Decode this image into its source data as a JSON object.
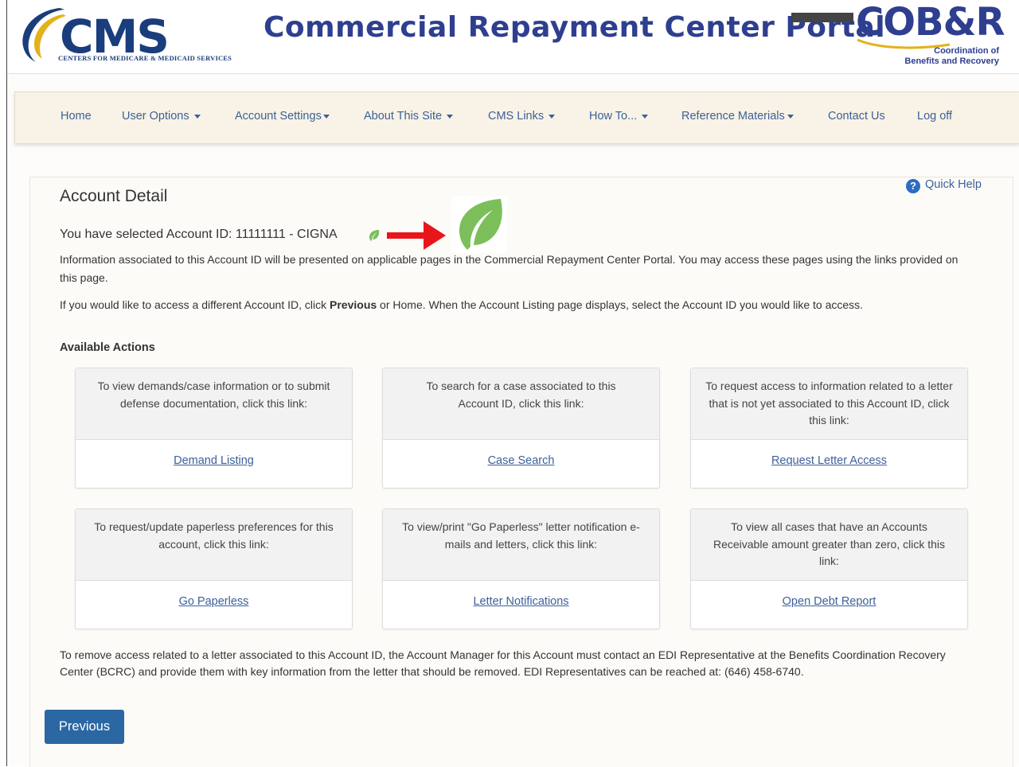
{
  "header": {
    "cms_logo_text": "CMS",
    "cms_logo_subtitle": "CENTERS FOR MEDICARE & MEDICAID SERVICES",
    "portal_title": "Commercial Repayment Center Portal",
    "cobr_logo_text": "COB&R",
    "cobr_logo_line1": "Coordination of",
    "cobr_logo_line2": "Benefits and Recovery"
  },
  "nav": {
    "items": [
      {
        "label": "Home",
        "dropdown": false
      },
      {
        "label": "User Options",
        "dropdown": true
      },
      {
        "label": "Account Settings",
        "dropdown": true
      },
      {
        "label": "About This Site",
        "dropdown": true
      },
      {
        "label": "CMS Links",
        "dropdown": true
      },
      {
        "label": "How To...",
        "dropdown": true
      },
      {
        "label": "Reference Materials",
        "dropdown": true
      },
      {
        "label": "Contact Us",
        "dropdown": false
      },
      {
        "label": "Log off",
        "dropdown": false
      }
    ]
  },
  "main": {
    "title": "Account Detail",
    "quick_help": "Quick Help",
    "selected_account": "You have selected Account ID: 11111111 - CIGNA",
    "info_para": "Information associated to this Account ID will be presented on applicable pages in the Commercial Repayment Center Portal. You may access these pages using the links provided on this page.",
    "access_para_before": "If you would like to access a different Account ID, click ",
    "access_para_bold": "Previous",
    "access_para_after": " or Home. When the Account Listing page displays, select the Account ID you would like to access.",
    "available_actions": "Available Actions",
    "cards": [
      {
        "text": "To view demands/case information or to submit defense documentation, click this link:",
        "link": "Demand Listing"
      },
      {
        "text": "To search for a case associated to this Account ID, click this link:",
        "link": "Case Search"
      },
      {
        "text": "To request access to information related to a letter that is not yet associated to this Account ID, click this link:",
        "link": "Request Letter Access"
      },
      {
        "text": "To request/update paperless preferences for this account, click this link:",
        "link": "Go Paperless"
      },
      {
        "text": "To view/print \"Go Paperless\" letter notification e-mails and letters, click this link:",
        "link": "Letter Notifications"
      },
      {
        "text": "To view all cases that have an Accounts Receivable amount greater than zero, click this link:",
        "link": "Open Debt Report"
      }
    ],
    "remove_para": "To remove access related to a letter associated to this Account ID, the Account Manager for this Account must contact an EDI Representative at the Benefits Coordination Recovery Center (BCRC) and provide them with key information from the letter that should be removed. EDI Representatives can be reached at: (646) 458-6740.",
    "previous_button": "Previous"
  },
  "colors": {
    "brand_blue": "#2e3f8f",
    "link_blue": "#3d5f9a",
    "button_blue": "#2a67a3",
    "nav_bg": "#f8f3e6",
    "leaf_green": "#7cbf5a",
    "arrow_red": "#e8161b"
  },
  "icons": {
    "help": "question-circle-icon",
    "leaf": "green-leaf-icon",
    "arrow": "red-arrow-icon"
  }
}
